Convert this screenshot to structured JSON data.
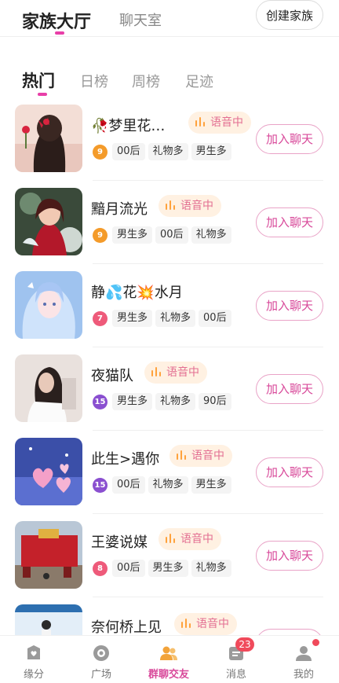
{
  "header": {
    "tabs": [
      {
        "label": "家族大厅",
        "active": true
      },
      {
        "label": "聊天室",
        "active": false
      }
    ],
    "create_button": "创建家族"
  },
  "subtabs": [
    {
      "label": "热门",
      "active": true
    },
    {
      "label": "日榜",
      "active": false
    },
    {
      "label": "周榜",
      "active": false
    },
    {
      "label": "足迹",
      "active": false
    }
  ],
  "voice_label": "语音中",
  "join_label": "加入聊天",
  "families": [
    {
      "name": "🥀梦里花…",
      "voice": true,
      "level": "9",
      "level_color": "#f49b2a",
      "tags": [
        "00后",
        "礼物多",
        "男生多"
      ],
      "thumb": "girl-rose"
    },
    {
      "name": "黯月流光",
      "voice": true,
      "level": "9",
      "level_color": "#f49b2a",
      "tags": [
        "男生多",
        "00后",
        "礼物多"
      ],
      "thumb": "anime-red"
    },
    {
      "name": "静💦花💥水月",
      "voice": false,
      "level": "7",
      "level_color": "#ee5a7a",
      "tags": [
        "男生多",
        "礼物多",
        "00后"
      ],
      "thumb": "anime-blue"
    },
    {
      "name": "夜猫队",
      "voice": true,
      "level": "15",
      "level_color": "#8a4fd0",
      "tags": [
        "男生多",
        "礼物多",
        "90后"
      ],
      "thumb": "girl-white"
    },
    {
      "name": "此生>遇你",
      "voice": true,
      "level": "15",
      "level_color": "#8a4fd0",
      "tags": [
        "00后",
        "礼物多",
        "男生多"
      ],
      "thumb": "hearts"
    },
    {
      "name": "王婆说媒",
      "voice": true,
      "level": "8",
      "level_color": "#ee5a7a",
      "tags": [
        "00后",
        "男生多",
        "礼物多"
      ],
      "thumb": "red-stage"
    },
    {
      "name": "奈何桥上见",
      "voice": true,
      "level": "",
      "level_color": "#8a4fd0",
      "tags": [],
      "thumb": "blue-stage"
    }
  ],
  "bottom_nav": [
    {
      "label": "缘分",
      "icon": "heart-box-icon",
      "active": false,
      "badge": ""
    },
    {
      "label": "广场",
      "icon": "plaza-icon",
      "active": false,
      "badge": ""
    },
    {
      "label": "群聊交友",
      "icon": "group-chat-icon",
      "active": true,
      "badge": ""
    },
    {
      "label": "消息",
      "icon": "message-icon",
      "active": false,
      "badge": "23"
    },
    {
      "label": "我的",
      "icon": "profile-icon",
      "active": false,
      "badge": "dot"
    }
  ],
  "colors": {
    "accent": "#d8499a",
    "voice_bg": "#fff1e2",
    "voice_bars": "#ffa23c"
  }
}
